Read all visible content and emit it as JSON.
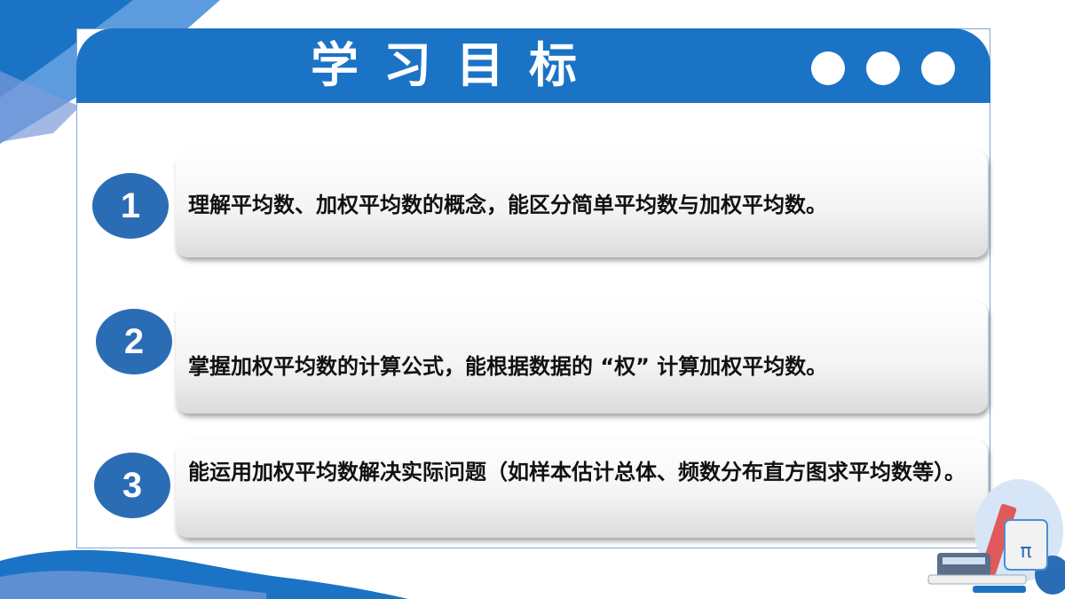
{
  "header": {
    "title": "学习目标"
  },
  "objectives": [
    {
      "number": "1",
      "text": "理解平均数、加权平均数的概念，能区分简单平均数与加权平均数。"
    },
    {
      "number": "2",
      "text": "掌握加权平均数的计算公式，能根据数据的 “权” 计算加权平均数。"
    },
    {
      "number": "3",
      "text": "能运用加权平均数解决实际问题（如样本估计总体、频数分布直方图求平均数等）。"
    }
  ],
  "colors": {
    "accent": "#1b73c6",
    "badge": "#2a6db5",
    "deco_light": "#7fa7d6"
  },
  "icons": [
    "three-dot-indicator-icon",
    "pi-symbol-icon",
    "pencil-icon",
    "calculator-icon"
  ],
  "illustration": {
    "symbol": "π"
  }
}
